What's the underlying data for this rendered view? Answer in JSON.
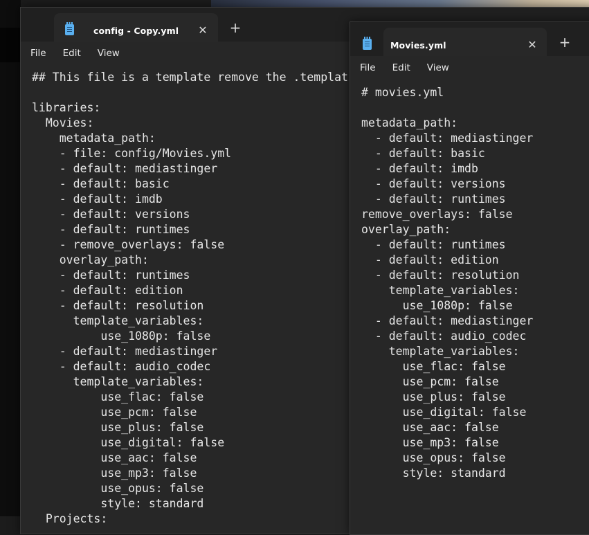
{
  "window1": {
    "tab_title": "config - Copy.yml",
    "menu": [
      "File",
      "Edit",
      "View"
    ],
    "lines": [
      "## This file is a template remove the .templat",
      "",
      "libraries:",
      "  Movies:",
      "    metadata_path:",
      "    - file: config/Movies.yml",
      "    - default: mediastinger",
      "    - default: basic",
      "    - default: imdb",
      "    - default: versions",
      "    - default: runtimes",
      "    - remove_overlays: false",
      "    overlay_path:",
      "    - default: runtimes",
      "    - default: edition",
      "    - default: resolution",
      "      template_variables:",
      "          use_1080p: false",
      "    - default: mediastinger",
      "    - default: audio_codec",
      "      template_variables:",
      "          use_flac: false",
      "          use_pcm: false",
      "          use_plus: false",
      "          use_digital: false",
      "          use_aac: false",
      "          use_mp3: false",
      "          use_opus: false",
      "          style: standard",
      "  Projects:"
    ]
  },
  "window2": {
    "tab_title": "Movies.yml",
    "menu": [
      "File",
      "Edit",
      "View"
    ],
    "lines": [
      "# movies.yml",
      "",
      "metadata_path:",
      "  - default: mediastinger",
      "  - default: basic",
      "  - default: imdb",
      "  - default: versions",
      "  - default: runtimes",
      "remove_overlays: false",
      "overlay_path:",
      "  - default: runtimes",
      "  - default: edition",
      "  - default: resolution",
      "    template_variables:",
      "      use_1080p: false",
      "  - default: mediastinger",
      "  - default: audio_codec",
      "    template_variables:",
      "      use_flac: false",
      "      use_pcm: false",
      "      use_plus: false",
      "      use_digital: false",
      "      use_aac: false",
      "      use_mp3: false",
      "      use_opus: false",
      "      style: standard"
    ]
  },
  "icons": {
    "app": "notepad-icon",
    "close": "close-icon",
    "new_tab": "plus-icon"
  },
  "colors": {
    "tab_icon": "#5ab0f0",
    "text": "#e6e6e6",
    "editor_bg": "#272727",
    "titlebar_bg": "#202020"
  }
}
